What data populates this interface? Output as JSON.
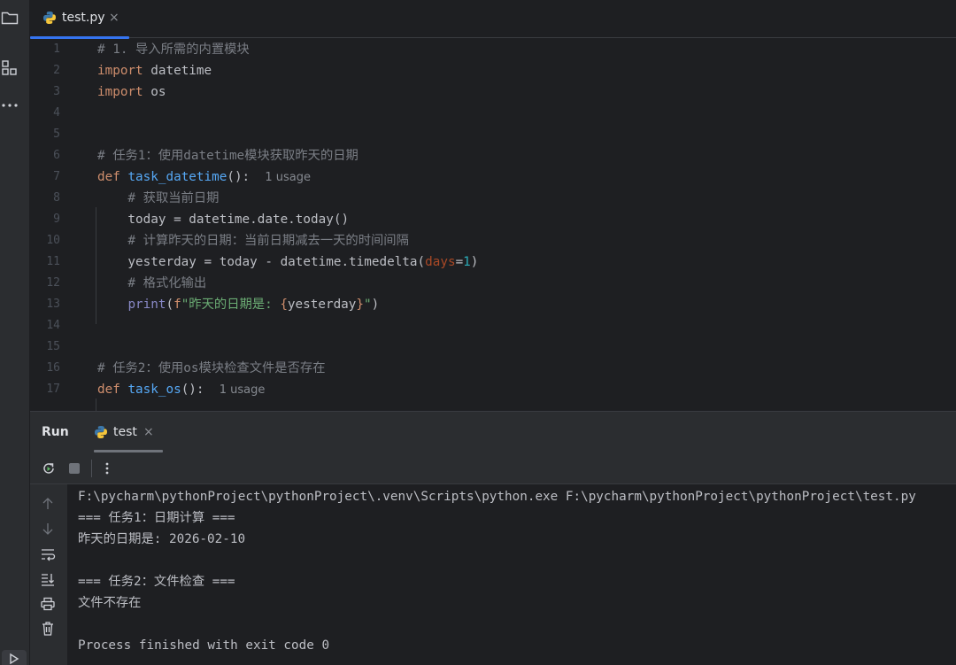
{
  "editor": {
    "tab": {
      "label": "test.py",
      "close": "×"
    },
    "lines": [
      {
        "n": "1",
        "segs": [
          {
            "c": "cm",
            "t": "# 1. 导入所需的内置模块"
          }
        ]
      },
      {
        "n": "2",
        "segs": [
          {
            "c": "kw",
            "t": "import"
          },
          {
            "c": "",
            "t": " datetime"
          }
        ]
      },
      {
        "n": "3",
        "segs": [
          {
            "c": "kw",
            "t": "import"
          },
          {
            "c": "",
            "t": " os"
          }
        ]
      },
      {
        "n": "4",
        "segs": []
      },
      {
        "n": "5",
        "segs": []
      },
      {
        "n": "6",
        "segs": [
          {
            "c": "cm",
            "t": "# 任务1：使用datetime模块获取昨天的日期"
          }
        ]
      },
      {
        "n": "7",
        "segs": [
          {
            "c": "kw",
            "t": "def"
          },
          {
            "c": "",
            "t": " "
          },
          {
            "c": "fn",
            "t": "task_datetime"
          },
          {
            "c": "",
            "t": "():  "
          },
          {
            "c": "hint",
            "t": "1 usage"
          }
        ]
      },
      {
        "n": "8",
        "segs": [
          {
            "c": "cm",
            "t": "    # 获取当前日期"
          }
        ]
      },
      {
        "n": "9",
        "segs": [
          {
            "c": "",
            "t": "    today = datetime.date.today()"
          }
        ]
      },
      {
        "n": "10",
        "segs": [
          {
            "c": "cm",
            "t": "    # 计算昨天的日期：当前日期减去一天的时间间隔"
          }
        ]
      },
      {
        "n": "11",
        "segs": [
          {
            "c": "",
            "t": "    yesterday = today - datetime.timedelta("
          },
          {
            "c": "param",
            "t": "days"
          },
          {
            "c": "",
            "t": "="
          },
          {
            "c": "num",
            "t": "1"
          },
          {
            "c": "",
            "t": ")"
          }
        ]
      },
      {
        "n": "12",
        "segs": [
          {
            "c": "cm",
            "t": "    # 格式化输出"
          }
        ]
      },
      {
        "n": "13",
        "segs": [
          {
            "c": "",
            "t": "    "
          },
          {
            "c": "bi",
            "t": "print"
          },
          {
            "c": "",
            "t": "("
          },
          {
            "c": "kw",
            "t": "f"
          },
          {
            "c": "str",
            "t": "\"昨天的日期是: "
          },
          {
            "c": "kw",
            "t": "{"
          },
          {
            "c": "",
            "t": "yesterday"
          },
          {
            "c": "kw",
            "t": "}"
          },
          {
            "c": "str",
            "t": "\""
          },
          {
            "c": "",
            "t": ")"
          }
        ]
      },
      {
        "n": "14",
        "segs": []
      },
      {
        "n": "15",
        "segs": []
      },
      {
        "n": "16",
        "segs": [
          {
            "c": "cm",
            "t": "# 任务2：使用os模块检查文件是否存在"
          }
        ]
      },
      {
        "n": "17",
        "segs": [
          {
            "c": "kw",
            "t": "def"
          },
          {
            "c": "",
            "t": " "
          },
          {
            "c": "fn",
            "t": "task_os"
          },
          {
            "c": "",
            "t": "():  "
          },
          {
            "c": "hint",
            "t": "1 usage"
          }
        ]
      }
    ]
  },
  "run": {
    "title": "Run",
    "tab_label": "test",
    "tab_close": "×",
    "console": [
      "F:\\pycharm\\pythonProject\\pythonProject\\.venv\\Scripts\\python.exe F:\\pycharm\\pythonProject\\pythonProject\\test.py",
      "=== 任务1：日期计算 ===",
      "昨天的日期是: 2026-02-10",
      "",
      "=== 任务2：文件检查 ===",
      "文件不存在",
      "",
      "Process finished with exit code 0"
    ]
  },
  "colors": {
    "accent": "#3574f0",
    "keyword": "#cf8e6d",
    "function": "#56a8f5",
    "comment": "#7a7e85",
    "string": "#6aab73"
  }
}
